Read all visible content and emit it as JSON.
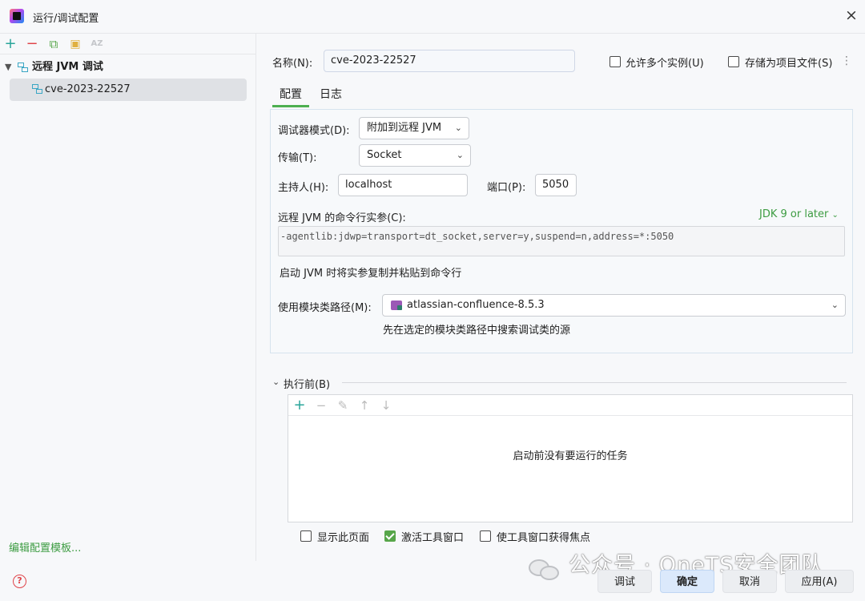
{
  "window": {
    "title": "运行/调试配置",
    "close_glyph": "×"
  },
  "left_toolbar": {
    "add": "+",
    "remove": "−",
    "copy": "⧉",
    "new_folder": "▣",
    "sort": "AZ"
  },
  "tree": {
    "group_label": "远程 JVM 调试",
    "items": [
      {
        "label": "cve-2023-22527"
      }
    ]
  },
  "edit_templates_link": "编辑配置模板...",
  "help_glyph": "?",
  "name_field": {
    "label": "名称(N):",
    "value": "cve-2023-22527"
  },
  "allow_parallel": {
    "label": "允许多个实例(U)",
    "checked": false
  },
  "store_as_file": {
    "label": "存储为项目文件(S)",
    "checked": false
  },
  "tabs": [
    {
      "label": "配置",
      "active": true
    },
    {
      "label": "日志",
      "active": false
    }
  ],
  "config": {
    "debugger_mode": {
      "label": "调试器模式(D):",
      "value": "附加到远程 JVM"
    },
    "transport": {
      "label": "传输(T):",
      "value": "Socket"
    },
    "host": {
      "label": "主持人(H):",
      "value": "localhost"
    },
    "port": {
      "label": "端口(P):",
      "value": "5050"
    },
    "cmd_args": {
      "label": "远程 JVM 的命令行实参(C):",
      "jdk_link": "JDK 9 or later",
      "value": "-agentlib:jdwp=transport=dt_socket,server=y,suspend=n,address=*:5050",
      "hint": "启动 JVM 时将实参复制并粘贴到命令行"
    },
    "module_classpath": {
      "label": "使用模块类路径(M):",
      "value": "atlassian-confluence-8.5.3",
      "hint": "先在选定的模块类路径中搜索调试类的源"
    }
  },
  "before_launch": {
    "title": "执行前(B)",
    "toolbar": {
      "add": "+",
      "remove": "−",
      "edit": "✎",
      "up": "↑",
      "down": "↓"
    },
    "empty_text": "启动前没有要运行的任务"
  },
  "options": {
    "show_page": {
      "label": "显示此页面",
      "checked": false
    },
    "activate_tool_window": {
      "label": "激活工具窗口",
      "checked": true
    },
    "focus_tool_window": {
      "label": "使工具窗口获得焦点",
      "checked": false
    }
  },
  "buttons": {
    "debug": "调试",
    "ok": "确定",
    "cancel": "取消",
    "apply": "应用(A)"
  },
  "watermark": {
    "text": "公众号 · OneTS安全团队"
  }
}
